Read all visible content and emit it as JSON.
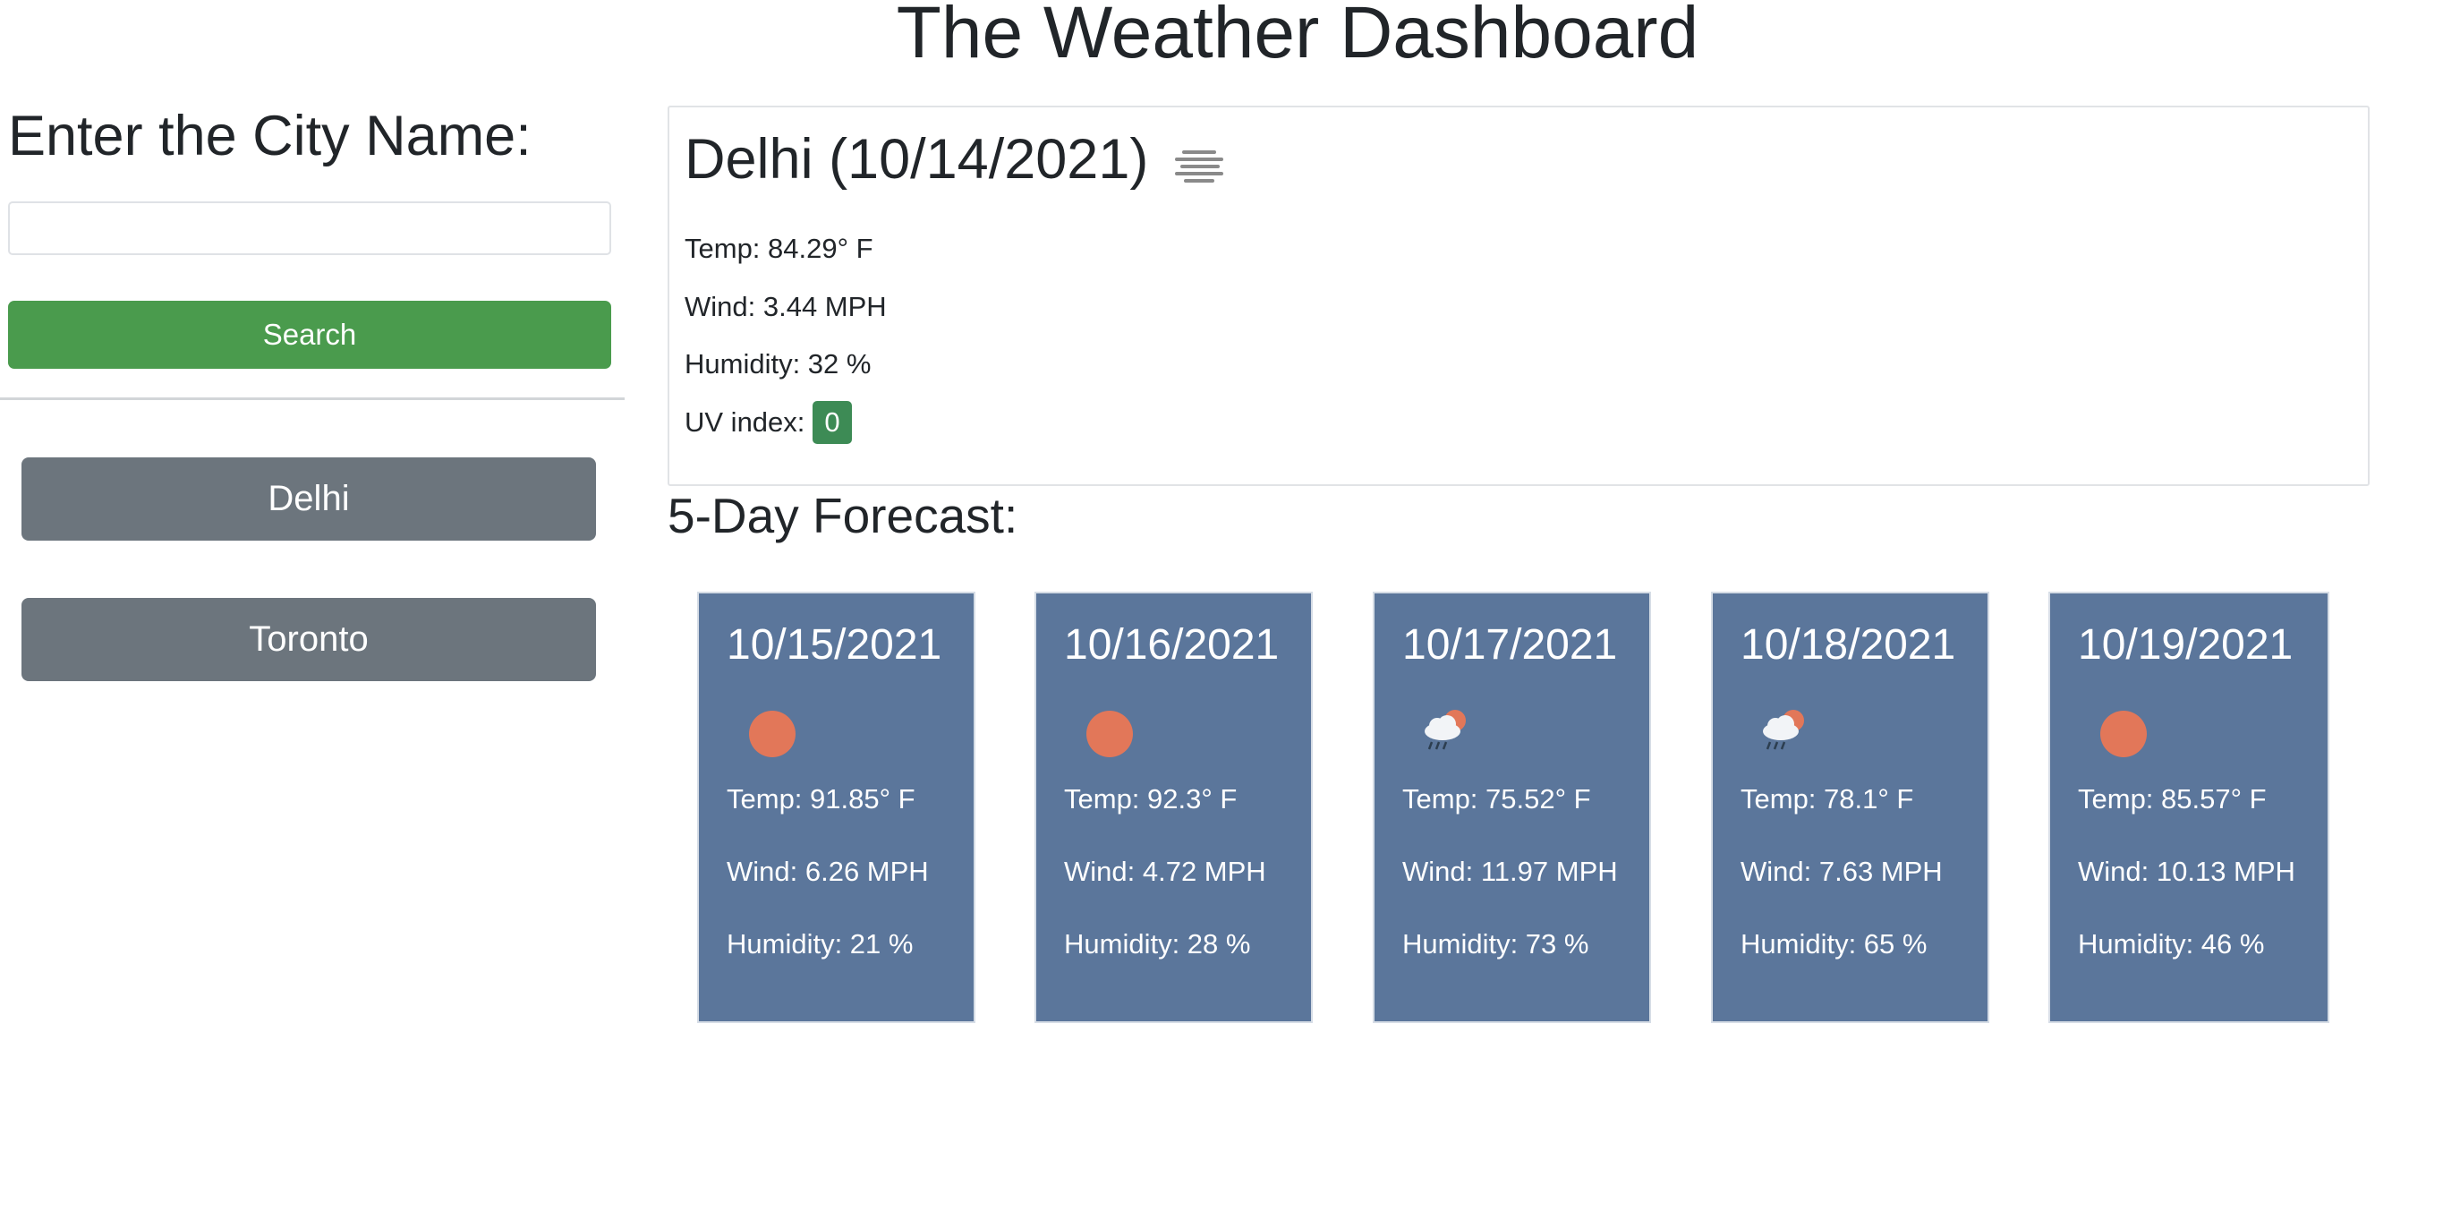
{
  "header": {
    "title": "The Weather Dashboard"
  },
  "sidebar": {
    "heading": "Enter the City Name:",
    "search_input": {
      "value": "",
      "placeholder": ""
    },
    "search_label": "Search",
    "history": [
      {
        "label": "Delhi"
      },
      {
        "label": "Toronto"
      }
    ]
  },
  "current": {
    "title": "Delhi (10/14/2021)",
    "icon": "mist-icon",
    "temp": "Temp: 84.29° F",
    "wind": "Wind: 3.44 MPH",
    "humidity": "Humidity: 32 %",
    "uv_label": "UV index:",
    "uv_value": "0",
    "uv_color": "#3d8b55"
  },
  "forecast": {
    "heading": "5-Day Forecast:",
    "card_color": "#5b769b",
    "days": [
      {
        "date": "10/15/2021",
        "icon": "sun-icon",
        "temp": "Temp: 91.85° F",
        "wind": "Wind: 6.26 MPH",
        "humidity": "Humidity: 21 %"
      },
      {
        "date": "10/16/2021",
        "icon": "sun-icon",
        "temp": "Temp: 92.3° F",
        "wind": "Wind: 4.72 MPH",
        "humidity": "Humidity: 28 %"
      },
      {
        "date": "10/17/2021",
        "icon": "rain-cloud-sun-icon",
        "temp": "Temp: 75.52° F",
        "wind": "Wind: 11.97 MPH",
        "humidity": "Humidity: 73 %"
      },
      {
        "date": "10/18/2021",
        "icon": "rain-cloud-sun-icon",
        "temp": "Temp: 78.1° F",
        "wind": "Wind: 7.63 MPH",
        "humidity": "Humidity: 65 %"
      },
      {
        "date": "10/19/2021",
        "icon": "sun-icon",
        "temp": "Temp: 85.57° F",
        "wind": "Wind: 10.13 MPH",
        "humidity": "Humidity: 46 %"
      }
    ]
  },
  "colors": {
    "search_button": "#4a9b4d",
    "history_button": "#6c757d",
    "sun": "#e27759"
  }
}
